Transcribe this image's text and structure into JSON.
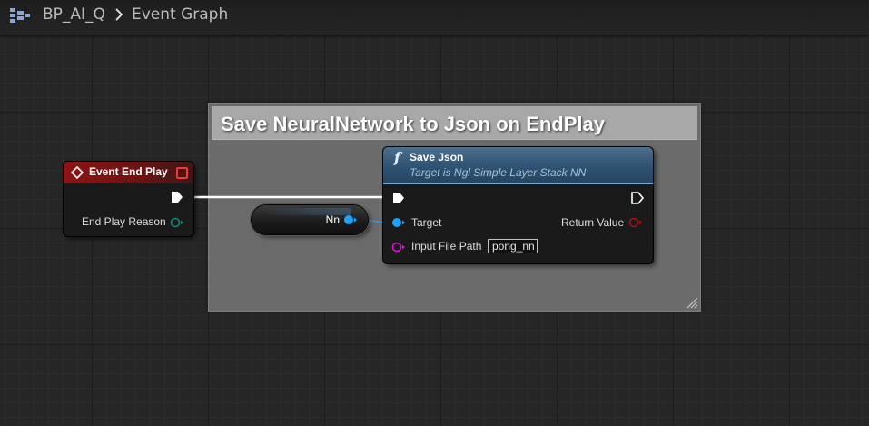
{
  "breadcrumb": {
    "asset_name": "BP_AI_Q",
    "graph_name": "Event Graph"
  },
  "comment": {
    "title": "Save NeuralNetwork to Json on EndPlay",
    "color": "#a8a8a8"
  },
  "nodes": {
    "event": {
      "title": "Event End Play",
      "output_pin": "End Play Reason",
      "header_color": "#8e1414"
    },
    "variable": {
      "label": "Nn",
      "pin_color": "#1aa3ff"
    },
    "function": {
      "icon": "function-icon",
      "title": "Save Json",
      "subtitle": "Target is Ngl Simple Layer Stack NN",
      "pins": {
        "target": "Target",
        "input_file_path": "Input File Path",
        "return_value": "Return Value"
      },
      "input_file_path_value": "pong_nn",
      "header_color": "#2f5272"
    }
  },
  "colors": {
    "exec_wire": "#ffffff",
    "object_pin": "#1aa3ff",
    "string_pin": "#e10fd7",
    "bool_pin": "#8c0c0c",
    "enum_pin": "#0d6b5e"
  }
}
